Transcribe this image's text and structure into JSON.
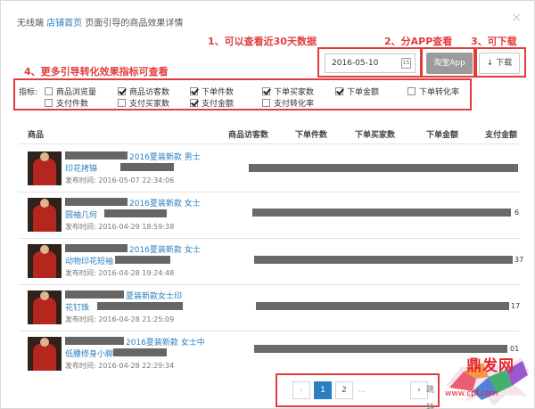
{
  "header": {
    "prefix": "无线端",
    "link": "店铺首页",
    "suffix": "页面引导的商品效果详情",
    "close": "×"
  },
  "annotations": {
    "a1": "1、可以查看近30天数据",
    "a2": "2、分APP查看",
    "a3": "3、可下载",
    "a4": "4、更多引导转化效果指标可查看"
  },
  "toolbar": {
    "date": "2016-05-10",
    "calendar_icon": "calendar-icon",
    "app_button": "淘宝App",
    "download_button": "下载",
    "download_icon": "↓"
  },
  "metrics": {
    "label": "指标:",
    "items": [
      {
        "label": "商品浏览量",
        "checked": false
      },
      {
        "label": "商品访客数",
        "checked": true
      },
      {
        "label": "下单件数",
        "checked": true
      },
      {
        "label": "下单买家数",
        "checked": true
      },
      {
        "label": "下单金额",
        "checked": true
      },
      {
        "label": "下单转化率",
        "checked": false
      },
      {
        "label": "支付件数",
        "checked": false
      },
      {
        "label": "支付买家数",
        "checked": false
      },
      {
        "label": "支付金额",
        "checked": true
      },
      {
        "label": "支付转化率",
        "checked": false
      }
    ]
  },
  "table": {
    "columns": [
      "商品",
      "商品访客数",
      "下单件数",
      "下单买家数",
      "下单金额",
      "支付金额"
    ],
    "rows": [
      {
        "title1": "2016夏装新款 男士",
        "title2": "印花拷锦",
        "publish": "发布时间: 2016-05-07 22:34:06",
        "tail": ""
      },
      {
        "title1": "2016夏装新款 女士",
        "title2": "圆袖几何",
        "publish": "发布时间: 2016-04-29 18:59:38",
        "tail": "6"
      },
      {
        "title1": "2016夏装新款 女士",
        "title2": "动物印花短袖",
        "publish": "发布时间: 2016-04-28 19:24:48",
        "tail": "37"
      },
      {
        "title1": "夏装新款女士印",
        "title2": "花钉珠",
        "publish": "发布时间: 2016-04-28 21:25:09",
        "tail": "17"
      },
      {
        "title1": "2016夏装新款 女士中",
        "title2": "低腰修身小脚",
        "publish": "发布时间: 2016-04-28 22:29:34",
        "tail": "01"
      }
    ]
  },
  "pagination": {
    "prev": "‹",
    "pages": [
      "1",
      "2"
    ],
    "ellipsis": "...",
    "next": "›",
    "goto": "跳转"
  },
  "watermark": {
    "text": "鼎发网",
    "url": "www.cpf.com"
  },
  "colors": {
    "annotation": "#e23c3c",
    "link": "#2a7fc0",
    "watermark": "#e5242b"
  }
}
